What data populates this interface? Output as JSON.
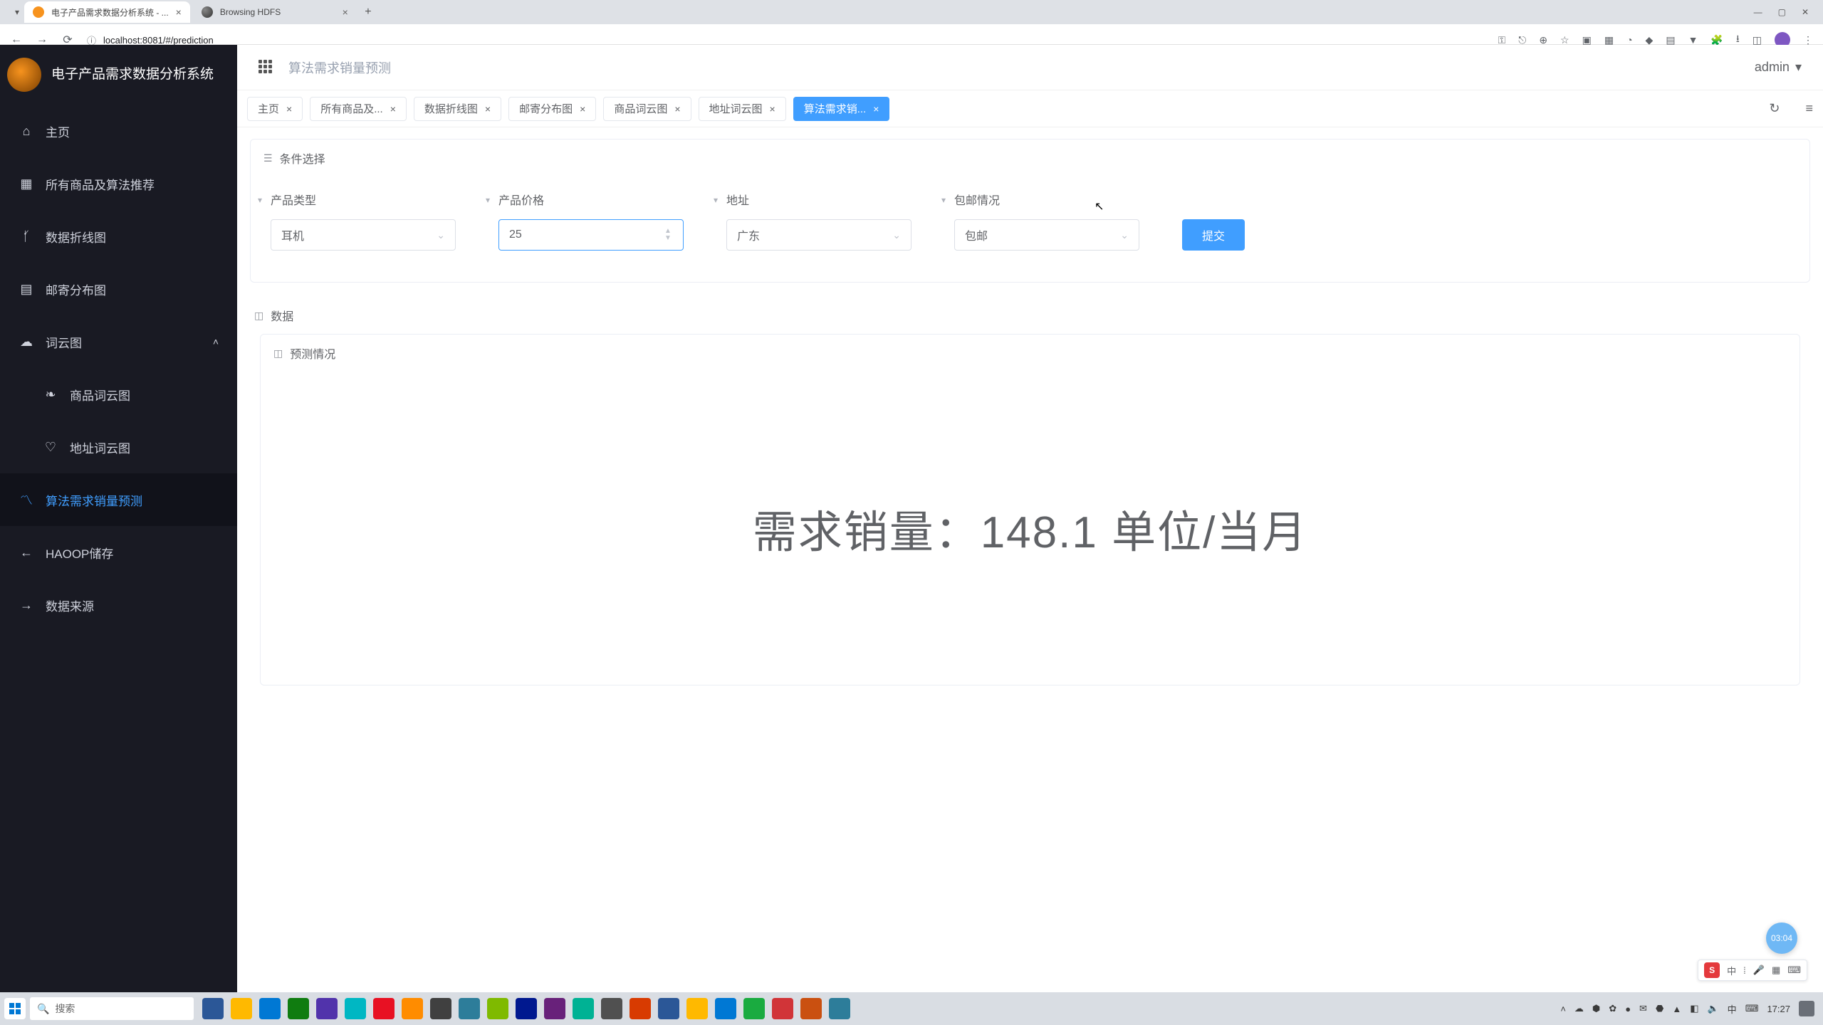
{
  "browser": {
    "tabs": [
      {
        "title": "电子产品需求数据分析系统 - ...",
        "active": true
      },
      {
        "title": "Browsing HDFS",
        "active": false
      }
    ],
    "url": "localhost:8081/#/prediction"
  },
  "app": {
    "brand": "电子产品需求数据分析系统",
    "breadcrumb": "算法需求销量预测",
    "user": "admin"
  },
  "sidebar": {
    "items": [
      {
        "label": "主页",
        "icon": "home"
      },
      {
        "label": "所有商品及算法推荐",
        "icon": "grid"
      },
      {
        "label": "数据折线图",
        "icon": "branch"
      },
      {
        "label": "邮寄分布图",
        "icon": "map"
      },
      {
        "label": "词云图",
        "icon": "cloud",
        "expandable": true
      },
      {
        "label": "商品词云图",
        "icon": "leaf",
        "sub": true
      },
      {
        "label": "地址词云图",
        "icon": "heart",
        "sub": true
      },
      {
        "label": "算法需求销量预测",
        "icon": "trend",
        "active": true
      },
      {
        "label": "HAOOP储存",
        "icon": "back"
      },
      {
        "label": "数据来源",
        "icon": "forward"
      }
    ]
  },
  "page_tabs": {
    "items": [
      {
        "label": "主页"
      },
      {
        "label": "所有商品及..."
      },
      {
        "label": "数据折线图"
      },
      {
        "label": "邮寄分布图"
      },
      {
        "label": "商品词云图"
      },
      {
        "label": "地址词云图"
      },
      {
        "label": "算法需求销...",
        "active": true
      }
    ],
    "refresh_icon": "↻",
    "menu_icon": "≡"
  },
  "form": {
    "panel_title": "条件选择",
    "fields": {
      "product_type": {
        "label": "产品类型",
        "value": "耳机"
      },
      "price": {
        "label": "产品价格",
        "value": "25"
      },
      "address": {
        "label": "地址",
        "value": "广东"
      },
      "shipping": {
        "label": "包邮情况",
        "value": "包邮"
      }
    },
    "submit": "提交"
  },
  "data_panel": {
    "title": "数据",
    "inner_title": "预测情况",
    "result_prefix": "需求销量：",
    "result_value": "148.1",
    "result_suffix": " 单位/当月"
  },
  "float_badge": "03:04",
  "ime": {
    "logo": "S",
    "items": [
      "中",
      "⁞",
      "🎤",
      "▦",
      "⌨"
    ]
  },
  "taskbar": {
    "search_placeholder": "搜索",
    "clock": "17:27"
  },
  "icon_map": {
    "home": "⌂",
    "grid": "▦",
    "branch": "ᚶ",
    "map": "▤",
    "cloud": "☁",
    "leaf": "❧",
    "heart": "♡",
    "trend": "〽",
    "back": "←",
    "forward": "→"
  },
  "tb_colors": [
    "#2b5797",
    "#ffb900",
    "#0078d4",
    "#107c10",
    "#5133ab",
    "#00b7c3",
    "#e81123",
    "#ff8c00",
    "#404040",
    "#2d7d9a",
    "#7fba00",
    "#00188f",
    "#68217a",
    "#00b294",
    "#505050",
    "#d83b01",
    "#2b5797",
    "#ffb900",
    "#0078d4",
    "#1aab40",
    "#d13438",
    "#ca5010",
    "#2d7d9a"
  ]
}
